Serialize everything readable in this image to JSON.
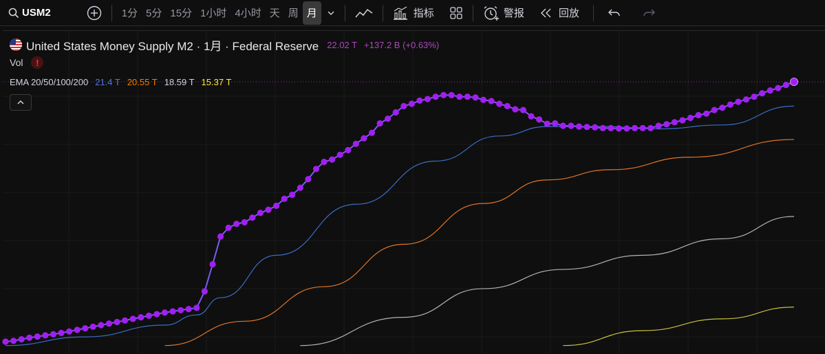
{
  "toolbar": {
    "symbol": "USM2",
    "intervals": [
      "1分",
      "5分",
      "15分",
      "1小时",
      "4小时",
      "天",
      "周",
      "月"
    ],
    "active_interval": "月",
    "indicators_label": "指标",
    "alert_label": "警报",
    "replay_label": "回放"
  },
  "legend": {
    "title": "United States Money Supply M2 · 1月 · Federal Reserve",
    "price": "22.02 T",
    "change": "+137.2 B (+0.63%)",
    "vol_label": "Vol",
    "ema_label": "EMA 20/50/100/200",
    "ema_values": [
      {
        "value": "21.4 T",
        "color": "#2962ff"
      },
      {
        "value": "20.55 T",
        "color": "#f57c00"
      },
      {
        "value": "18.59 T",
        "color": "#d1d4dc"
      },
      {
        "value": "15.37 T",
        "color": "#ffeb3b"
      }
    ],
    "collapse_icon": "chevron-up-icon"
  },
  "colors": {
    "m2_line": "#7b5cf5",
    "m2_dots": "#a020f0",
    "ema20": "#3a6ec8",
    "ema50": "#e0752b",
    "ema100": "#b5b5b5",
    "ema200": "#c8c340",
    "price_line": "#9c27b0"
  },
  "chart_data": {
    "type": "line",
    "title": "United States Money Supply M2",
    "unit": "T",
    "x_label": "",
    "y_label": "",
    "series": [
      {
        "name": "M2",
        "values": [
          15.4,
          15.42,
          15.46,
          15.5,
          15.53,
          15.56,
          15.59,
          15.62,
          15.66,
          15.7,
          15.74,
          15.78,
          15.82,
          15.86,
          15.9,
          15.94,
          15.98,
          16.02,
          16.06,
          16.1,
          16.14,
          16.17,
          16.2,
          16.23,
          16.26,
          16.68,
          17.37,
          18.08,
          18.3,
          18.4,
          18.44,
          18.56,
          18.68,
          18.76,
          18.86,
          19.04,
          19.14,
          19.32,
          19.54,
          19.8,
          19.98,
          20.04,
          20.16,
          20.28,
          20.44,
          20.58,
          20.72,
          20.96,
          21.08,
          21.24,
          21.4,
          21.46,
          21.54,
          21.58,
          21.64,
          21.68,
          21.68,
          21.64,
          21.64,
          21.62,
          21.56,
          21.53,
          21.46,
          21.4,
          21.32,
          21.3,
          21.14,
          21.06,
          20.95,
          20.96,
          20.9,
          20.9,
          20.88,
          20.87,
          20.86,
          20.84,
          20.84,
          20.83,
          20.83,
          20.84,
          20.84,
          20.84,
          20.9,
          20.94,
          20.99,
          21.04,
          21.1,
          21.17,
          21.21,
          21.3,
          21.36,
          21.44,
          21.51,
          21.57,
          21.64,
          21.73,
          21.8,
          21.86,
          21.94,
          22.02
        ]
      },
      {
        "name": "EMA 20",
        "x_range": [
          0,
          99
        ],
        "points": [
          [
            0,
            15.3
          ],
          [
            10,
            15.52
          ],
          [
            20,
            15.82
          ],
          [
            24,
            16.08
          ],
          [
            27,
            16.52
          ],
          [
            34,
            17.6
          ],
          [
            44,
            18.9
          ],
          [
            54,
            20.0
          ],
          [
            62,
            20.64
          ],
          [
            68,
            20.88
          ],
          [
            75,
            20.88
          ],
          [
            82,
            20.82
          ],
          [
            90,
            20.92
          ],
          [
            99,
            21.4
          ]
        ]
      },
      {
        "name": "EMA 50",
        "points": [
          [
            20,
            15.3
          ],
          [
            30,
            15.92
          ],
          [
            40,
            16.8
          ],
          [
            50,
            17.88
          ],
          [
            60,
            18.92
          ],
          [
            68,
            19.52
          ],
          [
            76,
            19.78
          ],
          [
            86,
            20.1
          ],
          [
            99,
            20.55
          ]
        ]
      },
      {
        "name": "EMA 100",
        "points": [
          [
            37,
            15.3
          ],
          [
            50,
            16.02
          ],
          [
            60,
            16.75
          ],
          [
            70,
            17.24
          ],
          [
            80,
            17.6
          ],
          [
            90,
            18.02
          ],
          [
            99,
            18.59
          ]
        ]
      },
      {
        "name": "EMA 200",
        "points": [
          [
            70,
            15.3
          ],
          [
            80,
            15.68
          ],
          [
            90,
            15.98
          ],
          [
            99,
            16.28
          ]
        ]
      }
    ],
    "ylim": [
      15.3,
      22.2
    ],
    "grid": true,
    "current_price": 22.02
  }
}
